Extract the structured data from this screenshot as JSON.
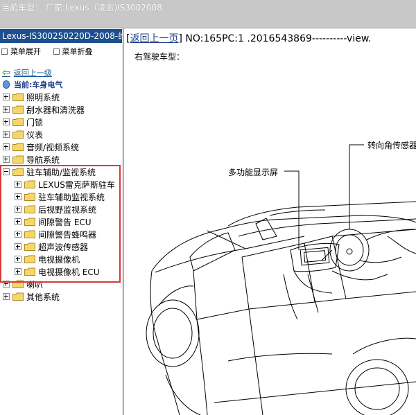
{
  "window": {
    "title": "当前车型： 厂家:Lexus（凌志)IS3002008"
  },
  "sidebar": {
    "title": "Lexus-IS300250220D-2008-维",
    "expand_label": "菜单展开",
    "collapse_label": "菜单折叠",
    "back_label": "返回上一级",
    "current_label": "当前:车身电气",
    "items": [
      {
        "label": "照明系统",
        "state": "plus"
      },
      {
        "label": "刮水器和清洗器",
        "state": "plus"
      },
      {
        "label": "门锁",
        "state": "plus"
      },
      {
        "label": "仪表",
        "state": "plus"
      },
      {
        "label": "音频/视频系统",
        "state": "plus"
      },
      {
        "label": "导航系统",
        "state": "plus"
      },
      {
        "label": "驻车辅助/监视系统",
        "state": "minus"
      },
      {
        "label": "LEXUS雷克萨斯驻车",
        "state": "plus"
      },
      {
        "label": "驻车辅助监视系统",
        "state": "plus"
      },
      {
        "label": "后视野监视系统",
        "state": "plus"
      },
      {
        "label": "间隙警告 ECU",
        "state": "plus"
      },
      {
        "label": "间隙警告蜂鸣器",
        "state": "plus"
      },
      {
        "label": "超声波传感器",
        "state": "plus"
      },
      {
        "label": "电视摄像机",
        "state": "plus"
      },
      {
        "label": "电视摄像机 ECU",
        "state": "plus"
      },
      {
        "label": "喇叭",
        "state": "plus"
      },
      {
        "label": "其他系统",
        "state": "plus"
      }
    ]
  },
  "main": {
    "back_link": "返回上一页",
    "header_info": "NO:165PC:1 .2016543869----------view.",
    "subtitle": "右驾驶车型：",
    "callout_display": "多功能显示屏",
    "callout_sensor": "转向角传感器"
  }
}
